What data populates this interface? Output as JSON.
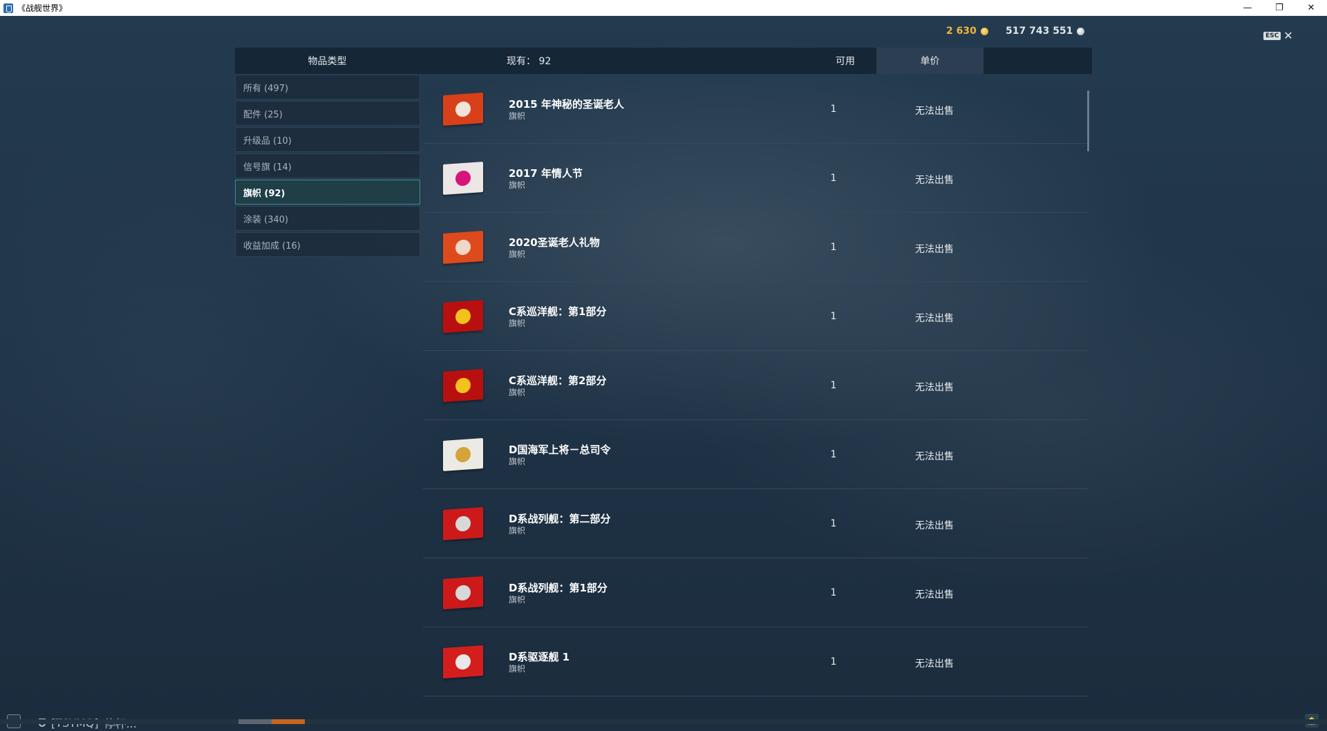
{
  "window": {
    "title": "《战舰世界》",
    "minimize": "—",
    "restore": "❐",
    "close": "✕"
  },
  "currency": {
    "gold": "2 630",
    "credits": "517 743 551"
  },
  "esc": {
    "key": "ESC",
    "close": "✕"
  },
  "header": {
    "type_label": "物品类型",
    "have_label": "现有：  92",
    "available_label": "可用",
    "price_label": "单价"
  },
  "sidebar": {
    "items": [
      {
        "label": "所有 (497)"
      },
      {
        "label": "配件 (25)"
      },
      {
        "label": "升级品 (10)"
      },
      {
        "label": "信号旗 (14)"
      },
      {
        "label": "旗帜 (92)"
      },
      {
        "label": "涂装 (340)"
      },
      {
        "label": "收益加成 (16)"
      }
    ],
    "active_index": 4
  },
  "items": [
    {
      "name": "2015 年神秘的圣诞老人",
      "category": "旗帜",
      "qty": "1",
      "price": "无法出售",
      "flag_color": "#d8401a",
      "emblem_color": "#f2e4da"
    },
    {
      "name": "2017 年情人节",
      "category": "旗帜",
      "qty": "1",
      "price": "无法出售",
      "flag_color": "#ece6e6",
      "emblem_color": "#d8147a"
    },
    {
      "name": "2020圣诞老人礼物",
      "category": "旗帜",
      "qty": "1",
      "price": "无法出售",
      "flag_color": "#de4a1c",
      "emblem_color": "#f1d7c8"
    },
    {
      "name": "C系巡洋舰：第1部分",
      "category": "旗帜",
      "qty": "1",
      "price": "无法出售",
      "flag_color": "#b8100f",
      "emblem_color": "#f3c21c"
    },
    {
      "name": "C系巡洋舰：第2部分",
      "category": "旗帜",
      "qty": "1",
      "price": "无法出售",
      "flag_color": "#b8100f",
      "emblem_color": "#f3c21c"
    },
    {
      "name": "D国海军上将－总司令",
      "category": "旗帜",
      "qty": "1",
      "price": "无法出售",
      "flag_color": "#eceae4",
      "emblem_color": "#d4a43a"
    },
    {
      "name": "D系战列舰：第二部分",
      "category": "旗帜",
      "qty": "1",
      "price": "无法出售",
      "flag_color": "#cc1a1a",
      "emblem_color": "#d8d8d8"
    },
    {
      "name": "D系战列舰：第1部分",
      "category": "旗帜",
      "qty": "1",
      "price": "无法出售",
      "flag_color": "#cc1a1a",
      "emblem_color": "#d8d8d8"
    },
    {
      "name": "D系驱逐舰 1",
      "category": "旗帜",
      "qty": "1",
      "price": "无法出售",
      "flag_color": "#d41e1e",
      "emblem_color": "#e8e8e8"
    }
  ],
  "bottom": {
    "clan": "[TSYMQ]",
    "status": "停杯..."
  }
}
